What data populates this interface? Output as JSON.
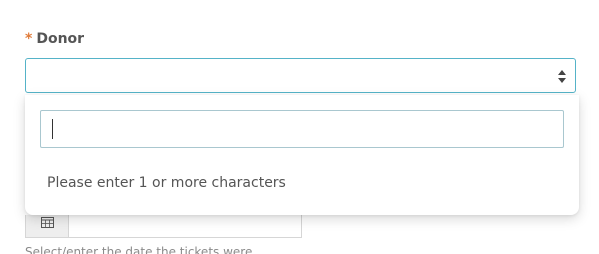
{
  "donor_field": {
    "required_marker": "*",
    "label": "Donor"
  },
  "donor_select": {
    "value": "",
    "arrow_icon": "sort-arrows-icon"
  },
  "dropdown": {
    "search_value": "",
    "message": "Please enter 1 or more characters"
  },
  "date_field": {
    "icon": "calendar-icon",
    "value": "",
    "help_text": "Select/enter the date the tickets were"
  },
  "colors": {
    "required": "#e07b3a",
    "focus_border": "#55b3c8",
    "label": "#555555",
    "help_text": "#8a8a8a"
  }
}
